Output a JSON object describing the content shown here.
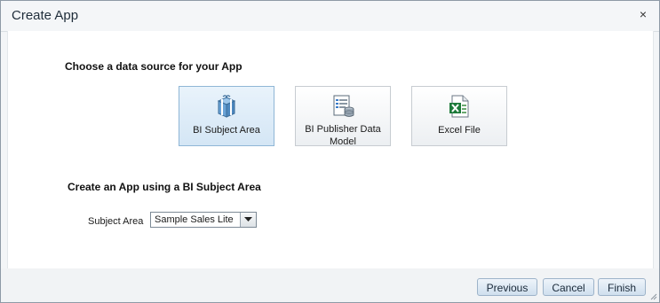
{
  "dialog": {
    "title": "Create App",
    "close_label": "×"
  },
  "choose": {
    "heading": "Choose a data source for your App",
    "tiles": [
      {
        "label": "BI Subject Area",
        "icon": "gift-box-icon",
        "selected": true
      },
      {
        "label": "BI Publisher Data Model",
        "icon": "data-model-icon",
        "selected": false
      },
      {
        "label": "Excel File",
        "icon": "excel-file-icon",
        "selected": false
      }
    ]
  },
  "create": {
    "heading": "Create an App using a BI Subject Area",
    "subject_area_label": "Subject Area",
    "subject_area_value": "Sample Sales Lite"
  },
  "footer": {
    "previous_label": "Previous",
    "cancel_label": "Cancel",
    "finish_label": "Finish"
  },
  "colors": {
    "selected_tile": "#d4e6f5",
    "button": "#cfdfee",
    "excel_green": "#1d7a3a"
  }
}
